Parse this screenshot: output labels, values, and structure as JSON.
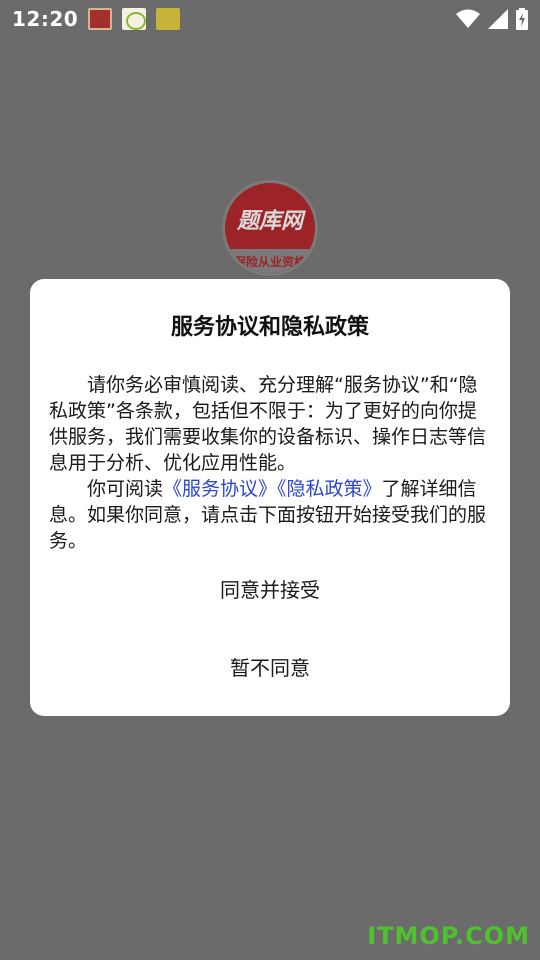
{
  "status_bar": {
    "time": "12:20"
  },
  "logo": {
    "text": "题库网",
    "subtext": "保险从业资格"
  },
  "dialog": {
    "title": "服务协议和隐私政策",
    "paragraph1": "请你务必审慎阅读、充分理解“服务协议”和“隐私政策”各条款，包括但不限于：为了更好的向你提供服务，我们需要收集你的设备标识、操作日志等信息用于分析、优化应用性能。",
    "paragraph2_prefix": "你可阅读",
    "link_service": "《服务协议》",
    "link_privacy": "《隐私政策》",
    "paragraph2_suffix": "了解详细信息。如果你同意，请点击下面按钮开始接受我们的服务。",
    "agree_label": "同意并接受",
    "disagree_label": "暂不同意"
  },
  "watermark": "ITMOP.COM",
  "colors": {
    "overlay": "#6b6b6b",
    "link": "#2b45d4",
    "watermark": "#4fc12e"
  }
}
